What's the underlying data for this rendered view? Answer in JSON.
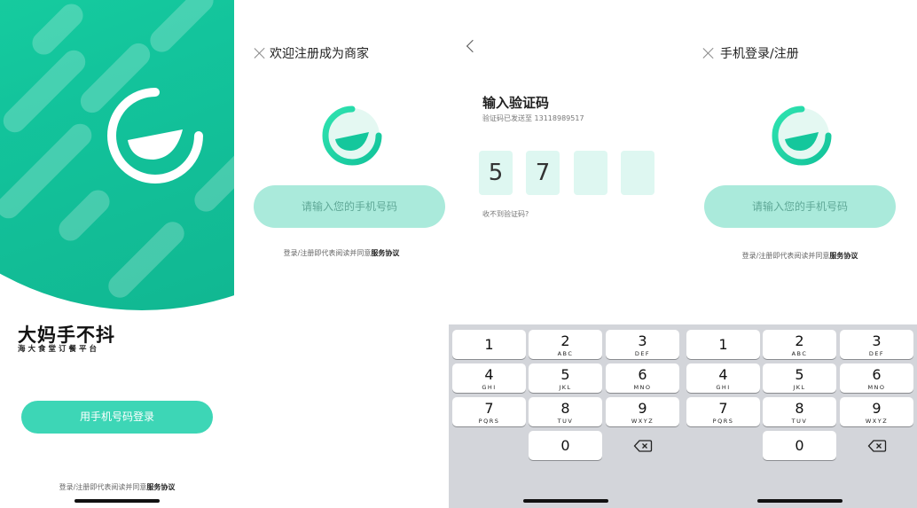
{
  "screen1": {
    "brand_title": "大妈手不抖",
    "brand_subtitle": "海大食堂订餐平台",
    "login_button": "用手机号码登录",
    "agreement_prefix": "登录/注册即代表阅读并同意",
    "agreement_link": "服务协议"
  },
  "screen2": {
    "title": "欢迎注册成为商家",
    "phone_placeholder": "请输入您的手机号码",
    "agreement_prefix": "登录/注册即代表阅读并同意",
    "agreement_link": "服务协议"
  },
  "screen3": {
    "title": "输入验证码",
    "sent_to": "验证码已发送至 13118989517",
    "code_digits": [
      "5",
      "7",
      "",
      ""
    ],
    "resend": "收不到验证码?"
  },
  "screen4": {
    "title": "手机登录/注册",
    "phone_placeholder": "请输入您的手机号码",
    "agreement_prefix": "登录/注册即代表阅读并同意",
    "agreement_link": "服务协议"
  },
  "keypad": {
    "keys": [
      {
        "num": "1",
        "letters": ""
      },
      {
        "num": "2",
        "letters": "ABC"
      },
      {
        "num": "3",
        "letters": "DEF"
      },
      {
        "num": "4",
        "letters": "GHI"
      },
      {
        "num": "5",
        "letters": "JKL"
      },
      {
        "num": "6",
        "letters": "MNO"
      },
      {
        "num": "7",
        "letters": "PQRS"
      },
      {
        "num": "8",
        "letters": "TUV"
      },
      {
        "num": "9",
        "letters": "WXYZ"
      },
      {
        "num": "0",
        "letters": ""
      }
    ]
  },
  "colors": {
    "brand_green": "#1ee0a6",
    "button_green": "#3dd6b6",
    "button_light": "#aaeadb",
    "code_box_bg": "#def7f1",
    "keypad_bg": "#d3d5da"
  }
}
